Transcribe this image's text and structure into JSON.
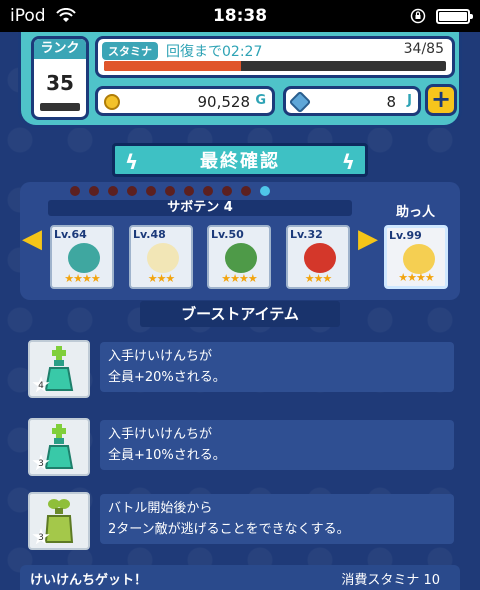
{
  "status_bar": {
    "carrier": "iPod",
    "time": "18:38"
  },
  "header": {
    "rank_label": "ランク",
    "rank_value": "35",
    "stamina_label": "スタミナ",
    "stamina_recover_text": "回復まで02:27",
    "stamina_count": "34/85",
    "stamina_fraction": 0.4,
    "gold_value": "90,528",
    "gold_unit": "G",
    "gem_value": "8",
    "gem_unit": "J",
    "plus_label": "+"
  },
  "title": "最終確認",
  "party": {
    "page_count": 11,
    "active_page": 10,
    "team_name": "サボテン 4",
    "helper_label": "助っ人",
    "units": [
      {
        "level": "Lv.64",
        "stars": "★★★★",
        "face_color": "#3fa7a0"
      },
      {
        "level": "Lv.48",
        "stars": "★★★",
        "face_color": "#f2e6b6"
      },
      {
        "level": "Lv.50",
        "stars": "★★★★",
        "face_color": "#4e9a48"
      },
      {
        "level": "Lv.32",
        "stars": "★★★",
        "face_color": "#d4372a"
      }
    ],
    "helper": {
      "level": "Lv.99",
      "stars": "★★★★",
      "face_color": "#f5cf52"
    }
  },
  "boost_title": "ブーストアイテム",
  "items": [
    {
      "count": "4",
      "line1": "入手けいけんちが",
      "line2": "全員+20%される。",
      "potion_color": "#39c9a8"
    },
    {
      "count": "3",
      "line1": "入手けいけんちが",
      "line2": "全員+10%される。",
      "potion_color": "#39c9a8"
    },
    {
      "count": "3",
      "line1": "バトル開始後から",
      "line2": "2ターン敵が逃げることをできなくする。",
      "potion_color": "#a4c84a"
    }
  ],
  "footer": {
    "left": "けいけんちゲット！",
    "right": "消費スタミナ 10"
  }
}
